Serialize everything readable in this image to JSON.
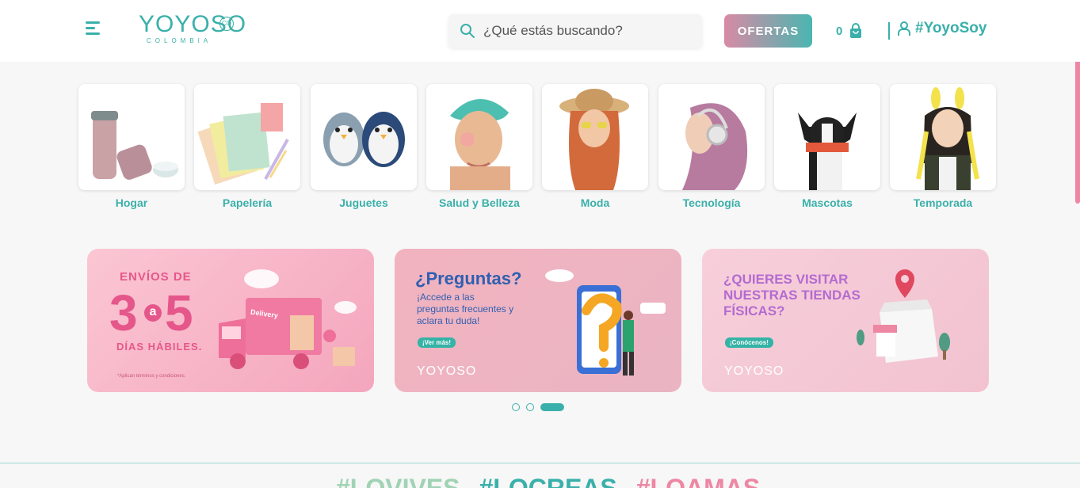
{
  "header": {
    "logo": {
      "main": "YOYOSO",
      "badge": "CO",
      "sub": "COLOMBIA"
    },
    "search": {
      "placeholder": "¿Qué estás buscando?"
    },
    "offers_label": "OFERTAS",
    "cart_count": "0",
    "account_label": "#YoyoSoy",
    "accent_color": "#3bb0aa"
  },
  "categories": [
    {
      "label": "Hogar",
      "icon": "thermos-image"
    },
    {
      "label": "Papelería",
      "icon": "stationery-image"
    },
    {
      "label": "Juguetes",
      "icon": "penguin-plush-image"
    },
    {
      "label": "Salud y Belleza",
      "icon": "skincare-woman-image"
    },
    {
      "label": "Moda",
      "icon": "hat-woman-image"
    },
    {
      "label": "Tecnología",
      "icon": "headphones-woman-image"
    },
    {
      "label": "Mascotas",
      "icon": "dog-image"
    },
    {
      "label": "Temporada",
      "icon": "bunny-ears-woman-image"
    }
  ],
  "banners": [
    {
      "line1": "ENVÍOS DE",
      "n1": "3",
      "mid": "a",
      "n2": "5",
      "line2": "DÍAS HÁBILES.",
      "truck_label": "Delivery",
      "note": "*Aplican términos y condiciones."
    },
    {
      "title": "¿Preguntas?",
      "body1": "¡Accede a las",
      "body2": "preguntas frecuentes y",
      "body3": "aclara tu duda!",
      "cta": "¡Ver más!",
      "brand": "YOYOSO"
    },
    {
      "title1": "¿QUIERES VISITAR",
      "title2": "NUESTRAS TIENDAS",
      "title3": "FÍSICAS?",
      "cta": "¡Conócenos!",
      "brand": "YOYOSO"
    }
  ],
  "carousel": {
    "slides": 3,
    "active": 3
  },
  "footer_tags": [
    {
      "text": "#LOVIVES",
      "color": "#9fd3b4"
    },
    {
      "text": "#LOCREAS",
      "color": "#3bb0aa"
    },
    {
      "text": "#LOAMAS",
      "color": "#ee87a3"
    }
  ]
}
